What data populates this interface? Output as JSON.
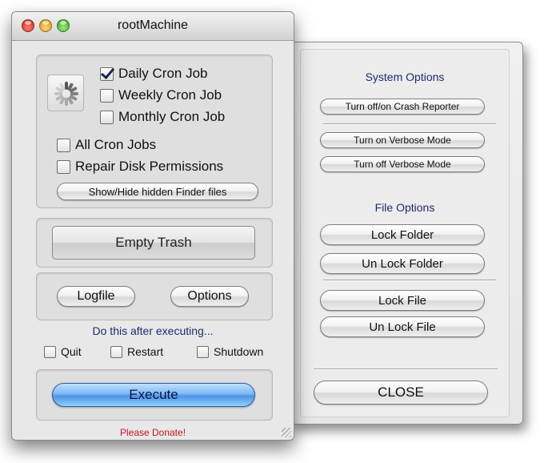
{
  "window": {
    "title": "rootMachine"
  },
  "cron": {
    "daily": {
      "label": "Daily Cron Job",
      "checked": true
    },
    "weekly": {
      "label": "Weekly Cron Job",
      "checked": false
    },
    "monthly": {
      "label": "Monthly Cron Job",
      "checked": false
    },
    "all": {
      "label": "All Cron Jobs",
      "checked": false
    },
    "repair": {
      "label": "Repair Disk Permissions",
      "checked": false
    },
    "finder_button": "Show/Hide hidden Finder files"
  },
  "actions": {
    "empty_trash": "Empty Trash",
    "logfile": "Logfile",
    "options": "Options",
    "after_text": "Do this after executing...",
    "quit": {
      "label": "Quit",
      "checked": false
    },
    "restart": {
      "label": "Restart",
      "checked": false
    },
    "shutdown": {
      "label": "Shutdown",
      "checked": false
    },
    "execute": "Execute",
    "donate": "Please Donate!"
  },
  "drawer": {
    "system_title": "System Options",
    "crash_reporter": "Turn off/on Crash Reporter",
    "verbose_on": "Turn on Verbose Mode",
    "verbose_off": "Turn off Verbose Mode",
    "file_title": "File Options",
    "lock_folder": "Lock Folder",
    "unlock_folder": "Un Lock Folder",
    "lock_file": "Lock File",
    "unlock_file": "Un Lock File",
    "close": "CLOSE"
  },
  "colors": {
    "accent_blue": "#4d93e6",
    "section_title": "#1e2a6e",
    "donate_red": "#c0151c"
  },
  "icons": {
    "spinner": "progress-spinner-icon",
    "checkmark": "checkmark-icon",
    "resize": "resize-grip-icon"
  }
}
